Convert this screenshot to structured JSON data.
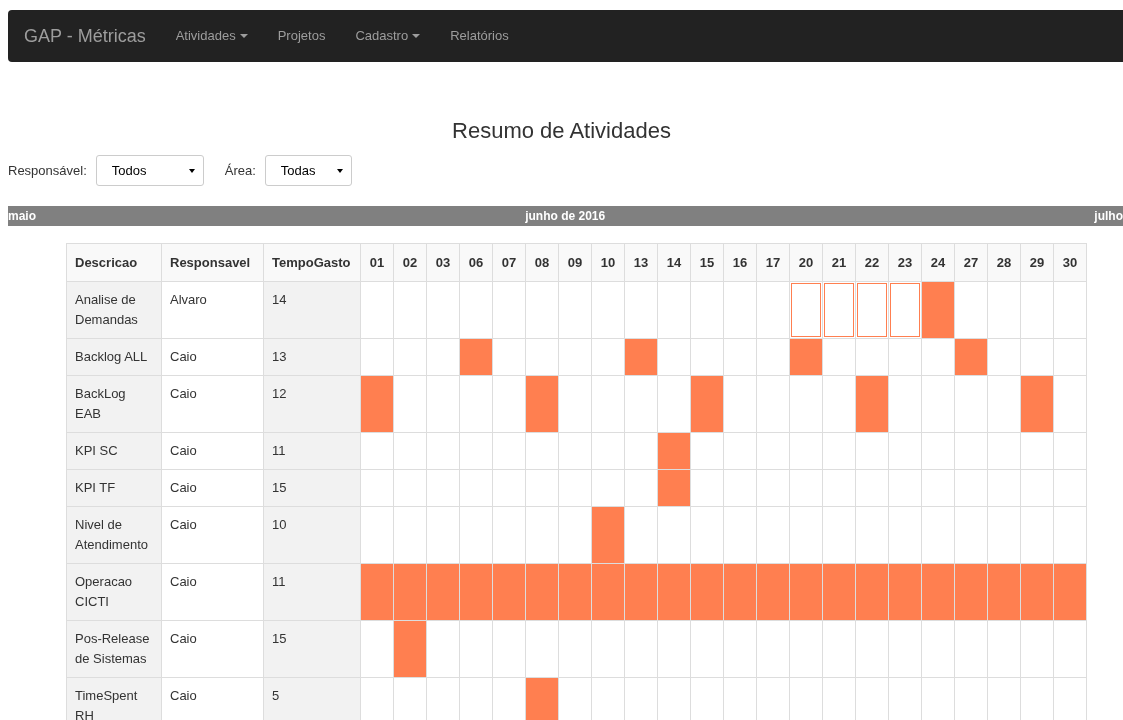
{
  "navbar": {
    "brand": "GAP - Métricas",
    "items": [
      {
        "label": "Atividades",
        "dropdown": true
      },
      {
        "label": "Projetos",
        "dropdown": false
      },
      {
        "label": "Cadastro",
        "dropdown": true
      },
      {
        "label": "Relatórios",
        "dropdown": false
      }
    ]
  },
  "title": "Resumo de Atividades",
  "filters": [
    {
      "label": "Responsável:",
      "value": "Todos"
    },
    {
      "label": "Área:",
      "value": "Todas"
    }
  ],
  "month_bar": {
    "previous": "maio",
    "current": "junho de 2016",
    "next": "julho"
  },
  "table": {
    "columns": [
      "Descricao",
      "Responsavel",
      "TempoGasto"
    ],
    "days": [
      "01",
      "02",
      "03",
      "06",
      "07",
      "08",
      "09",
      "10",
      "13",
      "14",
      "15",
      "16",
      "17",
      "20",
      "21",
      "22",
      "23",
      "24",
      "27",
      "28",
      "29",
      "30"
    ],
    "rows": [
      {
        "descricao": "Analise de Demandas",
        "responsavel": "Alvaro",
        "tempo": "14",
        "filled": [
          false,
          false,
          false,
          false,
          false,
          false,
          false,
          false,
          false,
          false,
          false,
          false,
          false,
          false,
          false,
          false,
          false,
          true,
          false,
          false,
          false,
          false
        ],
        "planned": [
          false,
          false,
          false,
          false,
          false,
          false,
          false,
          false,
          false,
          false,
          false,
          false,
          false,
          true,
          true,
          true,
          true,
          false,
          false,
          false,
          false,
          false
        ]
      },
      {
        "descricao": "Backlog ALL",
        "responsavel": "Caio",
        "tempo": "13",
        "filled": [
          false,
          false,
          false,
          true,
          false,
          false,
          false,
          false,
          true,
          false,
          false,
          false,
          false,
          true,
          false,
          false,
          false,
          false,
          true,
          false,
          false,
          false
        ],
        "planned": [
          false,
          false,
          false,
          false,
          false,
          false,
          false,
          false,
          false,
          false,
          false,
          false,
          false,
          false,
          false,
          false,
          false,
          false,
          false,
          false,
          false,
          false
        ]
      },
      {
        "descricao": "BackLog EAB",
        "responsavel": "Caio",
        "tempo": "12",
        "filled": [
          true,
          false,
          false,
          false,
          false,
          true,
          false,
          false,
          false,
          false,
          true,
          false,
          false,
          false,
          false,
          true,
          false,
          false,
          false,
          false,
          true,
          false
        ],
        "planned": [
          false,
          false,
          false,
          false,
          false,
          false,
          false,
          false,
          false,
          false,
          false,
          false,
          false,
          false,
          false,
          false,
          false,
          false,
          false,
          false,
          false,
          false
        ]
      },
      {
        "descricao": "KPI SC",
        "responsavel": "Caio",
        "tempo": "11",
        "filled": [
          false,
          false,
          false,
          false,
          false,
          false,
          false,
          false,
          false,
          true,
          false,
          false,
          false,
          false,
          false,
          false,
          false,
          false,
          false,
          false,
          false,
          false
        ],
        "planned": [
          false,
          false,
          false,
          false,
          false,
          false,
          false,
          false,
          false,
          false,
          false,
          false,
          false,
          false,
          false,
          false,
          false,
          false,
          false,
          false,
          false,
          false
        ]
      },
      {
        "descricao": "KPI TF",
        "responsavel": "Caio",
        "tempo": "15",
        "filled": [
          false,
          false,
          false,
          false,
          false,
          false,
          false,
          false,
          false,
          true,
          false,
          false,
          false,
          false,
          false,
          false,
          false,
          false,
          false,
          false,
          false,
          false
        ],
        "planned": [
          false,
          false,
          false,
          false,
          false,
          false,
          false,
          false,
          false,
          false,
          false,
          false,
          false,
          false,
          false,
          false,
          false,
          false,
          false,
          false,
          false,
          false
        ]
      },
      {
        "descricao": "Nivel de Atendimento",
        "responsavel": "Caio",
        "tempo": "10",
        "filled": [
          false,
          false,
          false,
          false,
          false,
          false,
          false,
          true,
          false,
          false,
          false,
          false,
          false,
          false,
          false,
          false,
          false,
          false,
          false,
          false,
          false,
          false
        ],
        "planned": [
          false,
          false,
          false,
          false,
          false,
          false,
          false,
          false,
          false,
          false,
          false,
          false,
          false,
          false,
          false,
          false,
          false,
          false,
          false,
          false,
          false,
          false
        ]
      },
      {
        "descricao": "Operacao CICTI",
        "responsavel": "Caio",
        "tempo": "11",
        "filled": [
          true,
          true,
          true,
          true,
          true,
          true,
          true,
          true,
          true,
          true,
          true,
          true,
          true,
          true,
          true,
          true,
          true,
          true,
          true,
          true,
          true,
          true
        ],
        "planned": [
          false,
          false,
          false,
          false,
          false,
          false,
          false,
          false,
          false,
          false,
          false,
          false,
          false,
          false,
          false,
          false,
          false,
          false,
          false,
          false,
          false,
          false
        ]
      },
      {
        "descricao": "Pos-Release de Sistemas",
        "responsavel": "Caio",
        "tempo": "15",
        "filled": [
          false,
          true,
          false,
          false,
          false,
          false,
          false,
          false,
          false,
          false,
          false,
          false,
          false,
          false,
          false,
          false,
          false,
          false,
          false,
          false,
          false,
          false
        ],
        "planned": [
          false,
          false,
          false,
          false,
          false,
          false,
          false,
          false,
          false,
          false,
          false,
          false,
          false,
          false,
          false,
          false,
          false,
          false,
          false,
          false,
          false,
          false
        ]
      },
      {
        "descricao": "TimeSpent RH",
        "responsavel": "Caio",
        "tempo": "5",
        "filled": [
          false,
          false,
          false,
          false,
          false,
          true,
          false,
          false,
          false,
          false,
          false,
          false,
          false,
          false,
          false,
          false,
          false,
          false,
          false,
          false,
          false,
          false
        ],
        "planned": [
          false,
          false,
          false,
          false,
          false,
          false,
          false,
          false,
          false,
          false,
          false,
          false,
          false,
          false,
          false,
          false,
          false,
          false,
          false,
          false,
          false,
          false
        ]
      }
    ]
  }
}
